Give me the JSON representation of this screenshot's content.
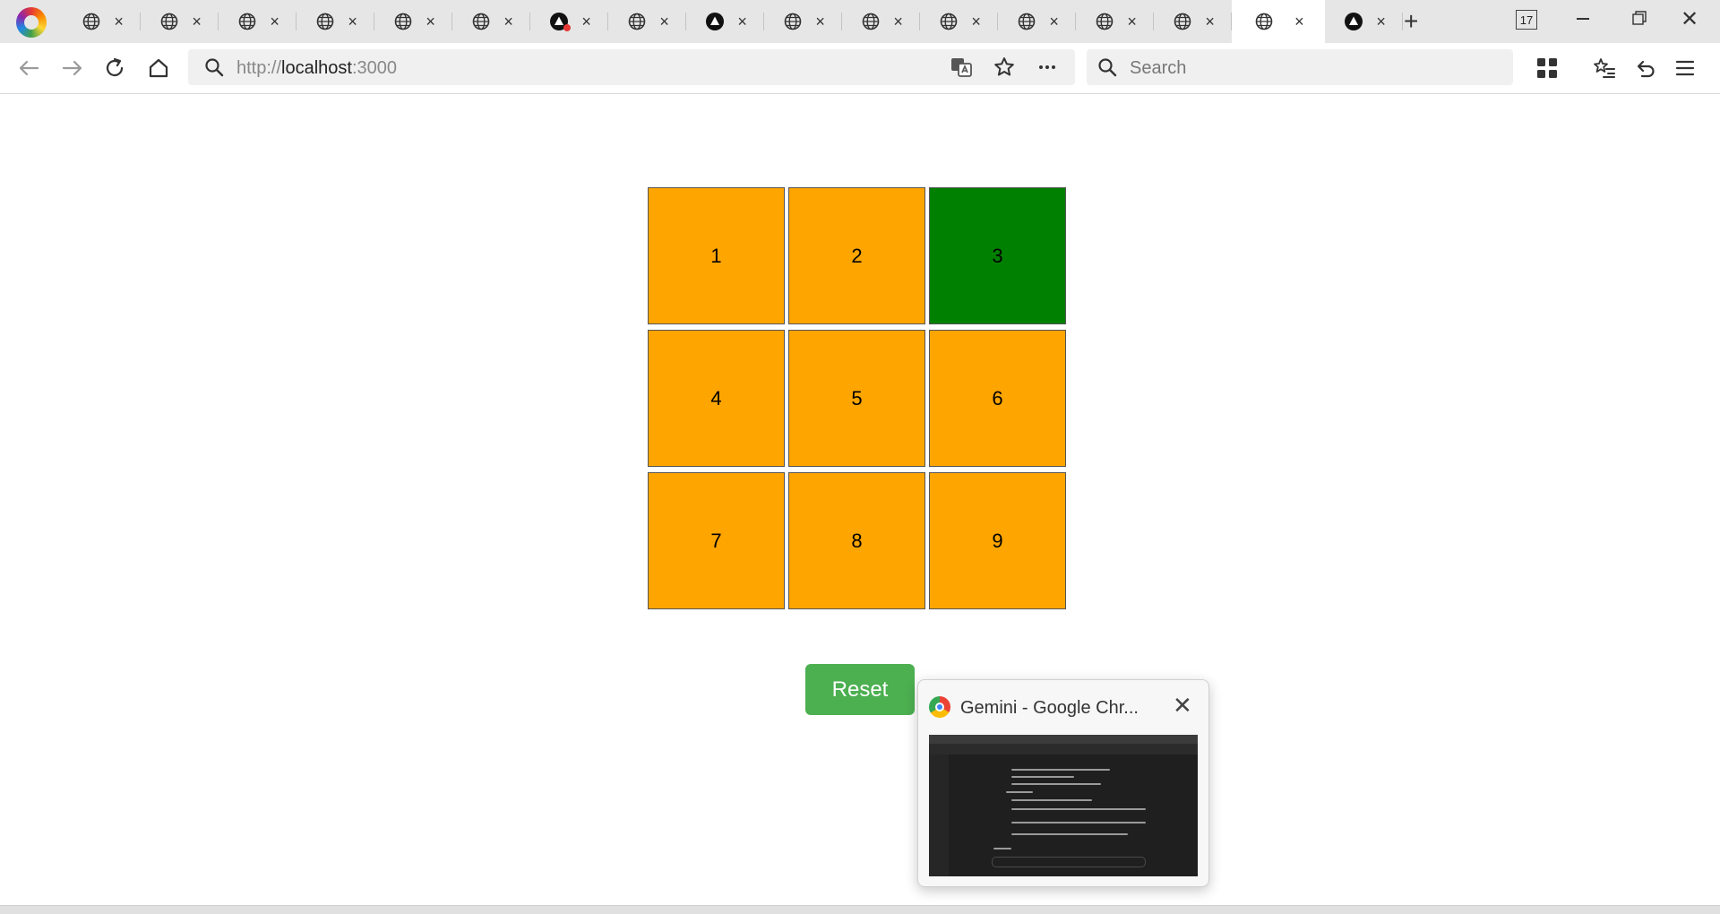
{
  "browser": {
    "tab_count_badge": "17",
    "new_tab_label": "+",
    "tabs": [
      {
        "icon": "globe-icon",
        "close": "×"
      },
      {
        "icon": "globe-icon",
        "close": "×"
      },
      {
        "icon": "globe-icon",
        "close": "×"
      },
      {
        "icon": "globe-icon",
        "close": "×"
      },
      {
        "icon": "globe-icon",
        "close": "×"
      },
      {
        "icon": "globe-icon",
        "close": "×"
      },
      {
        "icon": "triangle-logo-icon",
        "close": "×"
      },
      {
        "icon": "globe-icon",
        "close": "×"
      },
      {
        "icon": "triangle-logo-icon",
        "close": "×"
      },
      {
        "icon": "globe-icon",
        "close": "×"
      },
      {
        "icon": "globe-icon",
        "close": "×"
      },
      {
        "icon": "globe-icon",
        "close": "×"
      },
      {
        "icon": "globe-icon",
        "close": "×"
      },
      {
        "icon": "globe-icon",
        "close": "×"
      },
      {
        "icon": "globe-icon",
        "close": "×"
      },
      {
        "icon": "globe-icon",
        "close": "×",
        "active": true
      },
      {
        "icon": "triangle-logo-icon",
        "close": "×"
      }
    ],
    "window_close": "✕"
  },
  "toolbar": {
    "url_scheme": "http://",
    "url_host": "localhost",
    "url_port": ":3000",
    "search_placeholder": "Search"
  },
  "grid": {
    "cells": [
      {
        "label": "1",
        "selected": false
      },
      {
        "label": "2",
        "selected": false
      },
      {
        "label": "3",
        "selected": true
      },
      {
        "label": "4",
        "selected": false
      },
      {
        "label": "5",
        "selected": false
      },
      {
        "label": "6",
        "selected": false
      },
      {
        "label": "7",
        "selected": false
      },
      {
        "label": "8",
        "selected": false
      },
      {
        "label": "9",
        "selected": false
      }
    ],
    "colors": {
      "default": "#ffa500",
      "selected": "#008000"
    }
  },
  "reset_button": {
    "label": "Reset",
    "color": "#4caf50"
  },
  "preview": {
    "title": "Gemini - Google Chr...",
    "close": "✕"
  }
}
